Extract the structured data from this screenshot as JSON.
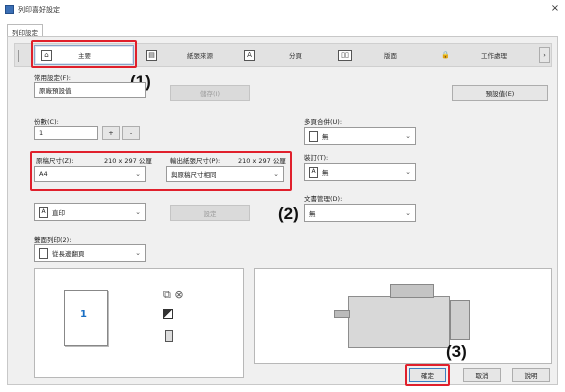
{
  "window": {
    "title": "列印喜好設定",
    "close_glyph": "×"
  },
  "tabs": [
    {
      "label": "列印設定"
    }
  ],
  "toolbar": {
    "items": [
      {
        "label": "主要",
        "icon": "home-icon"
      },
      {
        "label": "紙張來源",
        "icon": "paper-tray-icon"
      },
      {
        "label": "分頁",
        "icon": "page-icon"
      },
      {
        "label": "版面",
        "icon": "layout-icon"
      },
      {
        "label": "工作處理",
        "icon": "job-icon"
      }
    ],
    "more": "›"
  },
  "favorites": {
    "label": "常用設定(F):",
    "value": "原廠預設值",
    "save_label": "儲存(I)",
    "defaults_label": "預設值(E)"
  },
  "copies": {
    "label": "份數(C):",
    "value": "1",
    "plus": "+",
    "minus": "-"
  },
  "paper": {
    "original_label": "原稿尺寸(Z):",
    "original_dim": "210 x 297 公厘",
    "original_value": "A4",
    "output_label": "輸出紙張尺寸(P):",
    "output_dim": "210 x 297 公厘",
    "output_value": "與原稿尺寸相同"
  },
  "orientation": {
    "value": "直印"
  },
  "settings_button": "設定",
  "duplex": {
    "label": "雙面列印(2):",
    "value": "從長邊翻頁"
  },
  "right": {
    "nup_label": "多頁合併(U):",
    "nup_value": "無",
    "staple_label": "裝訂(T):",
    "staple_value": "無",
    "docfiling_label": "文書管理(D):",
    "docfiling_value": "無"
  },
  "preview": {
    "page_number": "1"
  },
  "callouts": {
    "c1": "(1)",
    "c2": "(2)",
    "c3": "(3)"
  },
  "footer": {
    "ok": "確定",
    "cancel": "取消",
    "help": "說明"
  },
  "colors": {
    "accent": "#e0202c",
    "page_number": "#1a6fc4"
  }
}
